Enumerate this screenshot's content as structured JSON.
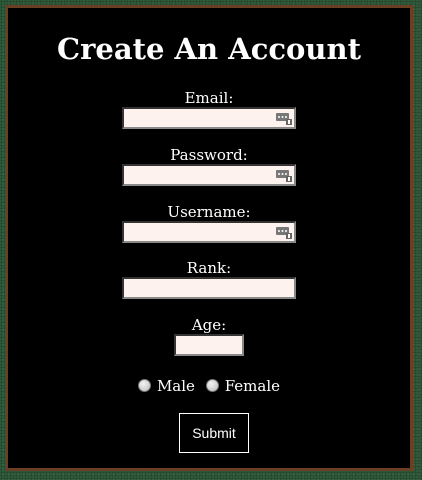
{
  "form": {
    "title": "Create An Account",
    "email": {
      "label": "Email:",
      "value": ""
    },
    "password": {
      "label": "Password:",
      "value": ""
    },
    "username": {
      "label": "Username:",
      "value": ""
    },
    "rank": {
      "label": "Rank:",
      "value": ""
    },
    "age": {
      "label": "Age:",
      "value": ""
    },
    "gender": {
      "male_label": "Male",
      "female_label": "Female"
    },
    "submit_label": "Submit"
  },
  "icons": {
    "autofill": "password-manager-key-icon"
  },
  "colors": {
    "page_bg": "#2f5a3a",
    "panel_bg": "#000000",
    "panel_border": "#6b3f24",
    "input_bg": "#fdf2ee",
    "text": "#ffffff"
  }
}
